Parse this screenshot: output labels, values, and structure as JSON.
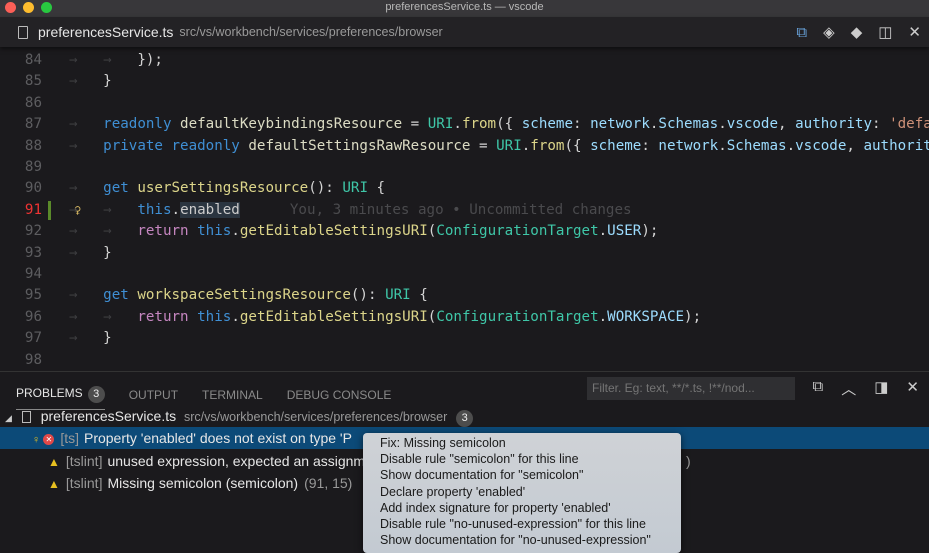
{
  "window": {
    "title": "preferencesService.ts — vscode"
  },
  "tab": {
    "filename": "preferencesService.ts",
    "path": "src/vs/workbench/services/preferences/browser",
    "action_icons": [
      "open-changes-icon",
      "toggle-blame-icon",
      "git-icon",
      "split-editor-icon",
      "close-icon"
    ]
  },
  "editor": {
    "lines": [
      {
        "n": "84",
        "indent": 2,
        "tokens": [
          [
            "o",
            "});"
          ]
        ]
      },
      {
        "n": "85",
        "indent": 1,
        "tokens": [
          [
            "o",
            "}"
          ]
        ]
      },
      {
        "n": "86",
        "indent": 0,
        "tokens": []
      },
      {
        "n": "87",
        "indent": 1,
        "tokens": [
          [
            "k",
            "readonly "
          ],
          [
            "i",
            "defaultKeybindingsResource "
          ],
          [
            "o",
            "= "
          ],
          [
            "t",
            "URI"
          ],
          [
            "o",
            "."
          ],
          [
            "f",
            "from"
          ],
          [
            "o",
            "({ "
          ],
          [
            "p",
            "scheme"
          ],
          [
            "o",
            ": "
          ],
          [
            "p",
            "network"
          ],
          [
            "o",
            "."
          ],
          [
            "p",
            "Schemas"
          ],
          [
            "o",
            "."
          ],
          [
            "p",
            "vscode"
          ],
          [
            "o",
            ", "
          ],
          [
            "p",
            "authority"
          ],
          [
            "o",
            ": "
          ],
          [
            "s",
            "'defa"
          ]
        ]
      },
      {
        "n": "88",
        "indent": 1,
        "tokens": [
          [
            "k",
            "private readonly "
          ],
          [
            "i",
            "defaultSettingsRawResource "
          ],
          [
            "o",
            "= "
          ],
          [
            "t",
            "URI"
          ],
          [
            "o",
            "."
          ],
          [
            "f",
            "from"
          ],
          [
            "o",
            "({ "
          ],
          [
            "p",
            "scheme"
          ],
          [
            "o",
            ": "
          ],
          [
            "p",
            "network"
          ],
          [
            "o",
            "."
          ],
          [
            "p",
            "Schemas"
          ],
          [
            "o",
            "."
          ],
          [
            "p",
            "vscode"
          ],
          [
            "o",
            ", "
          ],
          [
            "p",
            "authorit"
          ]
        ]
      },
      {
        "n": "89",
        "indent": 0,
        "tokens": []
      },
      {
        "n": "90",
        "indent": 1,
        "tokens": [
          [
            "k",
            "get "
          ],
          [
            "f",
            "userSettingsResource"
          ],
          [
            "o",
            "(): "
          ],
          [
            "t",
            "URI"
          ],
          [
            "o",
            " {"
          ]
        ]
      },
      {
        "n": "91",
        "indent": 2,
        "active": true,
        "tokens": [
          [
            "k",
            "this"
          ],
          [
            "o",
            "."
          ],
          [
            "sel",
            "enabled"
          ]
        ],
        "blame": "You, 3 minutes ago • Uncommitted changes"
      },
      {
        "n": "92",
        "indent": 2,
        "tokens": [
          [
            "r",
            "return "
          ],
          [
            "k",
            "this"
          ],
          [
            "o",
            "."
          ],
          [
            "f",
            "getEditableSettingsURI"
          ],
          [
            "o",
            "("
          ],
          [
            "t",
            "ConfigurationTarget"
          ],
          [
            "o",
            "."
          ],
          [
            "p",
            "USER"
          ],
          [
            "o",
            ");"
          ]
        ]
      },
      {
        "n": "93",
        "indent": 1,
        "tokens": [
          [
            "o",
            "}"
          ]
        ]
      },
      {
        "n": "94",
        "indent": 0,
        "tokens": []
      },
      {
        "n": "95",
        "indent": 1,
        "tokens": [
          [
            "k",
            "get "
          ],
          [
            "f",
            "workspaceSettingsResource"
          ],
          [
            "o",
            "(): "
          ],
          [
            "t",
            "URI"
          ],
          [
            "o",
            " {"
          ]
        ]
      },
      {
        "n": "96",
        "indent": 2,
        "tokens": [
          [
            "r",
            "return "
          ],
          [
            "k",
            "this"
          ],
          [
            "o",
            "."
          ],
          [
            "f",
            "getEditableSettingsURI"
          ],
          [
            "o",
            "("
          ],
          [
            "t",
            "ConfigurationTarget"
          ],
          [
            "o",
            "."
          ],
          [
            "p",
            "WORKSPACE"
          ],
          [
            "o",
            ");"
          ]
        ]
      },
      {
        "n": "97",
        "indent": 1,
        "tokens": [
          [
            "o",
            "}"
          ]
        ]
      },
      {
        "n": "98",
        "indent": 0,
        "tokens": []
      }
    ]
  },
  "panel": {
    "tabs": [
      {
        "label": "PROBLEMS",
        "badge": "3",
        "active": true
      },
      {
        "label": "OUTPUT"
      },
      {
        "label": "TERMINAL"
      },
      {
        "label": "DEBUG CONSOLE"
      }
    ],
    "filter_placeholder": "Filter. Eg: text, **/*.ts, !**/nod...",
    "file": {
      "name": "preferencesService.ts",
      "path": "src/vs/workbench/services/preferences/browser",
      "count": "3"
    },
    "problems": [
      {
        "severity": "error",
        "source": "[ts]",
        "message": "Property 'enabled' does not exist on type 'P",
        "selected": true
      },
      {
        "severity": "warning",
        "source": "[tslint]",
        "message": "unused expression, expected an assignm",
        "location": ")"
      },
      {
        "severity": "warning",
        "source": "[tslint]",
        "message": "Missing semicolon (semicolon)",
        "location": "(91, 15)"
      }
    ]
  },
  "quickfix": {
    "items": [
      "Fix: Missing semicolon",
      "Disable rule \"semicolon\" for this line",
      "Show documentation for \"semicolon\"",
      "Declare property 'enabled'",
      "Add index signature for property 'enabled'",
      "Disable rule \"no-unused-expression\" for this line",
      "Show documentation for \"no-unused-expression\""
    ]
  },
  "colors": {
    "accent": "#0c4a78",
    "error": "#e04848",
    "warning": "#e8c020",
    "git_added": "#5a8a2a"
  }
}
